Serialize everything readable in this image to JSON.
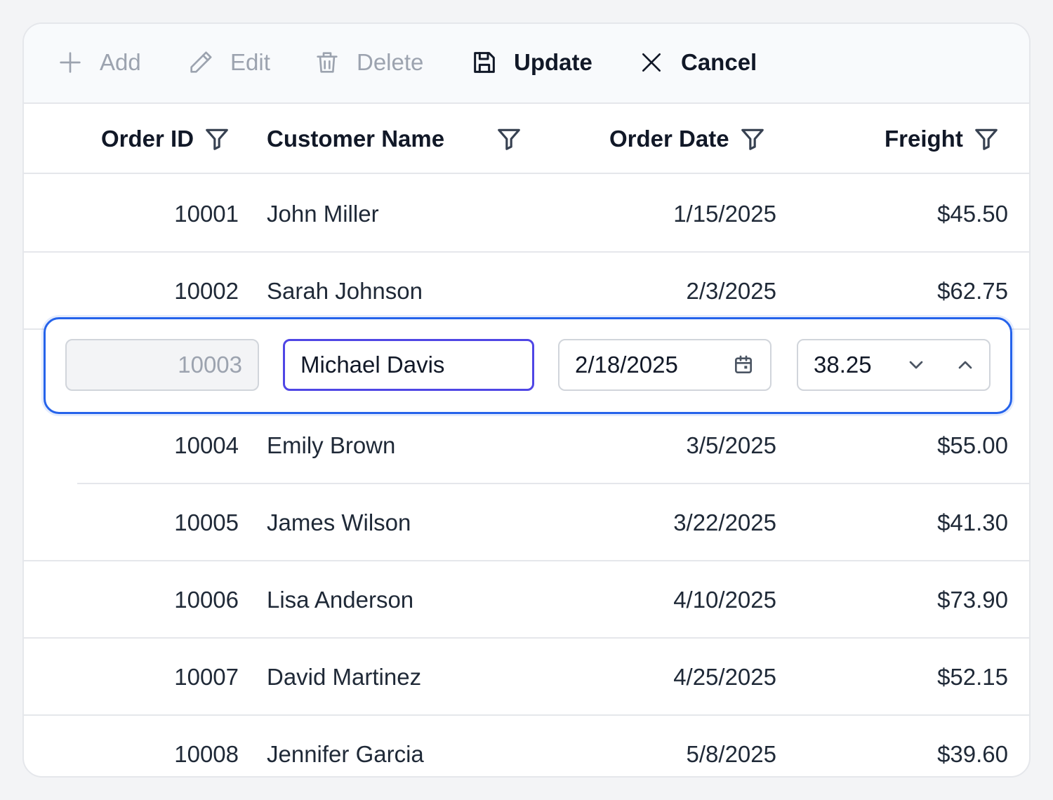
{
  "toolbar": {
    "add_label": "Add",
    "edit_label": "Edit",
    "delete_label": "Delete",
    "update_label": "Update",
    "cancel_label": "Cancel"
  },
  "columns": {
    "order_id": "Order ID",
    "customer_name": "Customer Name",
    "order_date": "Order Date",
    "freight": "Freight"
  },
  "rows": [
    {
      "id": "10001",
      "name": "John Miller",
      "date": "1/15/2025",
      "freight": "$45.50"
    },
    {
      "id": "10002",
      "name": "Sarah Johnson",
      "date": "2/3/2025",
      "freight": "$62.75"
    },
    {
      "id": "10004",
      "name": "Emily Brown",
      "date": "3/5/2025",
      "freight": "$55.00"
    },
    {
      "id": "10005",
      "name": "James Wilson",
      "date": "3/22/2025",
      "freight": "$41.30"
    },
    {
      "id": "10006",
      "name": "Lisa Anderson",
      "date": "4/10/2025",
      "freight": "$73.90"
    },
    {
      "id": "10007",
      "name": "David Martinez",
      "date": "4/25/2025",
      "freight": "$52.15"
    },
    {
      "id": "10008",
      "name": "Jennifer Garcia",
      "date": "5/8/2025",
      "freight": "$39.60"
    }
  ],
  "edit_row": {
    "id": "10003",
    "name": "Michael Davis",
    "date": "2/18/2025",
    "freight": "38.25"
  },
  "colors": {
    "edit_row_border": "#2563eb",
    "focused_input_border": "#4f46e5",
    "disabled_text": "#9ca3af"
  }
}
